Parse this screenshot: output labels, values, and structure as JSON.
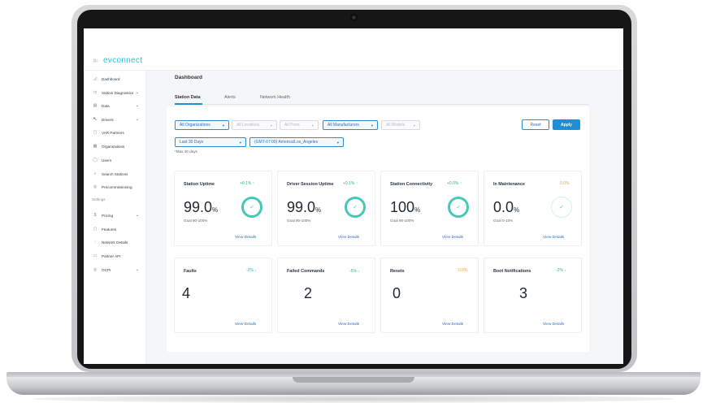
{
  "app": {
    "logo": "evconnect",
    "page_title": "Dashboard"
  },
  "sidebar": {
    "items": [
      {
        "label": "Dashboard",
        "icon": "chart-icon",
        "glyph": "◿",
        "chevron": ""
      },
      {
        "label": "Station Diagnostics",
        "icon": "clock-icon",
        "glyph": "◷",
        "chevron": "⌄"
      },
      {
        "label": "Data",
        "icon": "file-icon",
        "glyph": "▤",
        "chevron": "⌄"
      },
      {
        "label": "Drivers",
        "icon": "car-icon",
        "glyph": "⛍",
        "chevron": "⌄"
      },
      {
        "label": "VAR Partners",
        "icon": "partners-icon",
        "glyph": "▢",
        "chevron": ""
      },
      {
        "label": "Organizations",
        "icon": "grid-icon",
        "glyph": "▦",
        "chevron": ""
      },
      {
        "label": "Users",
        "icon": "user-icon",
        "glyph": "◯",
        "chevron": ""
      },
      {
        "label": "Search Stations",
        "icon": "search-icon",
        "glyph": "⌕",
        "chevron": ""
      },
      {
        "label": "Precommissioning",
        "icon": "target-icon",
        "glyph": "◎",
        "chevron": ""
      }
    ],
    "section_label": "Settings",
    "settings_items": [
      {
        "label": "Pricing",
        "icon": "dollar-icon",
        "glyph": "$",
        "chevron": "⌄"
      },
      {
        "label": "Features",
        "icon": "features-icon",
        "glyph": "▢",
        "chevron": ""
      },
      {
        "label": "Network Details",
        "icon": "network-icon",
        "glyph": "◌",
        "chevron": ""
      },
      {
        "label": "Partner API",
        "icon": "api-icon",
        "glyph": "▭",
        "chevron": ""
      },
      {
        "label": "OCPI",
        "icon": "ocpi-icon",
        "glyph": "◎",
        "chevron": "⌄"
      }
    ]
  },
  "tabs": [
    {
      "label": "Station Data",
      "active": true
    },
    {
      "label": "Alerts",
      "active": false
    },
    {
      "label": "Network Health",
      "active": false
    }
  ],
  "filters": {
    "organizations": "All Organizations",
    "locations": "All Locations",
    "ports": "All Ports",
    "manufacturers": "All Manufacturers",
    "models": "All Models",
    "date_range": "Last 30 Days",
    "timezone": "(GMT-07:00) America/Los_Angeles",
    "note": "*Max 30 days",
    "caret": "▾"
  },
  "buttons": {
    "reset": "Reset",
    "apply": "Apply"
  },
  "metric_cards": [
    {
      "title": "Station Uptime",
      "delta": "+0.1% ↑",
      "value": "99.0",
      "unit": "%",
      "goal": "Goal 90-100%",
      "link": "View Details",
      "check": "✓"
    },
    {
      "title": "Driver Session Uptime",
      "delta": "+0.1% ↑",
      "value": "99.0",
      "unit": "%",
      "goal": "Goal 90-100%",
      "link": "View Details",
      "check": "✓"
    },
    {
      "title": "Station Connectivity",
      "delta": "+0.0% ↑",
      "value": "100",
      "unit": "%",
      "goal": "Goal 90-100%",
      "link": "View Details",
      "check": "✓"
    },
    {
      "title": "In Maintenance",
      "delta": "0.0%",
      "value": "0.0",
      "unit": "%",
      "goal": "Goal 0-10%",
      "link": "View Details",
      "check": "✓"
    }
  ],
  "count_cards": [
    {
      "title": "Faults",
      "delta": "-2% ↓",
      "value": "4",
      "link": "View Details"
    },
    {
      "title": "Failed Commands",
      "delta": "-5% ↓",
      "value": "2",
      "link": "View Details"
    },
    {
      "title": "Resets",
      "delta": "0.0%",
      "value": "0",
      "link": "View Details"
    },
    {
      "title": "Boot Notifications",
      "delta": "-2% ↓",
      "value": "3",
      "link": "View Details"
    }
  ],
  "colors": {
    "accent": "#1e8fd6",
    "logo": "#2cc3d6",
    "positive": "#22b59a",
    "neutral": "#e9a23b",
    "ring": "#45c8b5"
  }
}
